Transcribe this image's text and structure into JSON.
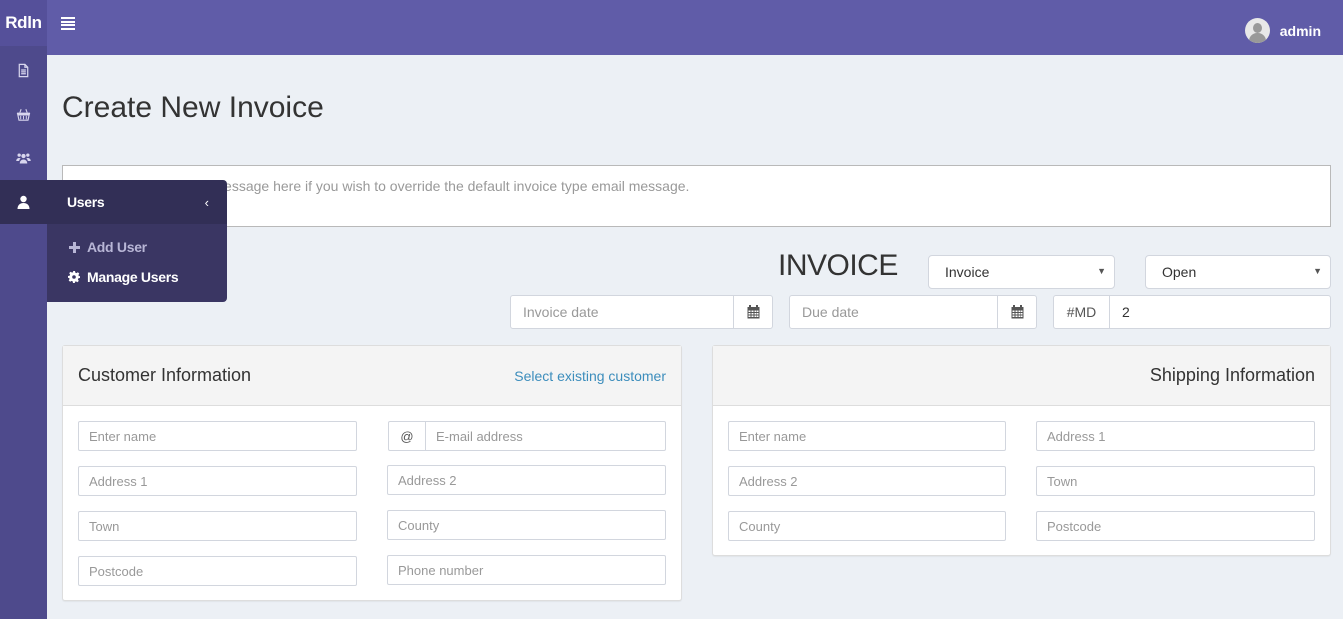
{
  "app": {
    "logo": "Rdln",
    "user_name": "admin"
  },
  "sidebar": {
    "icons": [
      "document-icon",
      "basket-icon",
      "users-group-icon",
      "user-icon"
    ],
    "flyout": {
      "title": "Users",
      "items": [
        {
          "label": "Add User",
          "icon": "plus-icon"
        },
        {
          "label": "Manage Users",
          "icon": "gear-icon"
        }
      ]
    }
  },
  "page": {
    "title": "Create New Invoice",
    "email_message_placeholder": "Enter a custom email message here if you wish to override the default invoice type email message.",
    "invoice_heading": "INVOICE",
    "invoice_type": {
      "selected": "Invoice"
    },
    "invoice_status": {
      "selected": "Open"
    },
    "invoice_date_placeholder": "Invoice date",
    "due_date_placeholder": "Due date",
    "invoice_prefix": "#MD",
    "invoice_number": "2"
  },
  "customer": {
    "title": "Customer Information",
    "select_existing_link": "Select existing customer",
    "email_addon": "@",
    "placeholders": {
      "name": "Enter name",
      "email": "E-mail address",
      "address1": "Address 1",
      "address2": "Address 2",
      "town": "Town",
      "county": "County",
      "postcode": "Postcode",
      "phone": "Phone number"
    }
  },
  "shipping": {
    "title": "Shipping Information",
    "placeholders": {
      "name": "Enter name",
      "address1": "Address 1",
      "address2": "Address 2",
      "town": "Town",
      "county": "County",
      "postcode": "Postcode"
    }
  },
  "colors": {
    "topbar": "#605ca8",
    "sidebar": "#4e4a8c",
    "flyout": "#322f56",
    "link": "#3c8dbc",
    "background": "#ecf0f5"
  }
}
